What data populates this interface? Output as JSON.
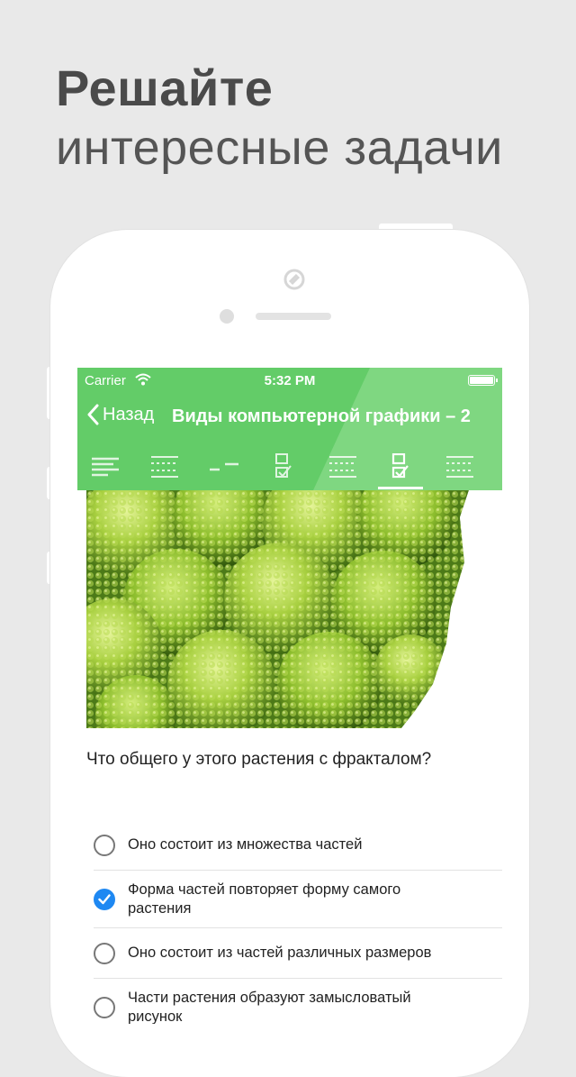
{
  "promo": {
    "line1": "Решайте",
    "line2": "интересные задачи"
  },
  "status_bar": {
    "carrier": "Carrier",
    "time": "5:32 PM"
  },
  "nav": {
    "back_label": "Назад",
    "title": "Виды компьютерной графики – 2"
  },
  "tabs": [
    {
      "icon": "text-lines-icon"
    },
    {
      "icon": "dotted-lines-icon"
    },
    {
      "icon": "fill-blank-icon"
    },
    {
      "icon": "checklist-icon"
    },
    {
      "icon": "dotted-lines-icon"
    },
    {
      "icon": "checklist-icon",
      "active": true
    },
    {
      "icon": "dotted-lines-icon"
    }
  ],
  "question": "Что общего у этого растения с фракталом?",
  "answers": [
    {
      "text": "Оно состоит из множества частей",
      "selected": false
    },
    {
      "line1": "Форма частей повторяет форму самого",
      "line2": "растения",
      "selected": true
    },
    {
      "text": "Оно состоит из частей различных размеров",
      "selected": false
    },
    {
      "line1": "Части растения образуют замысловатый",
      "line2": "рисунок",
      "selected": false
    }
  ],
  "colors": {
    "accent_green": "#63cc68",
    "selected_blue": "#1e88f2"
  }
}
